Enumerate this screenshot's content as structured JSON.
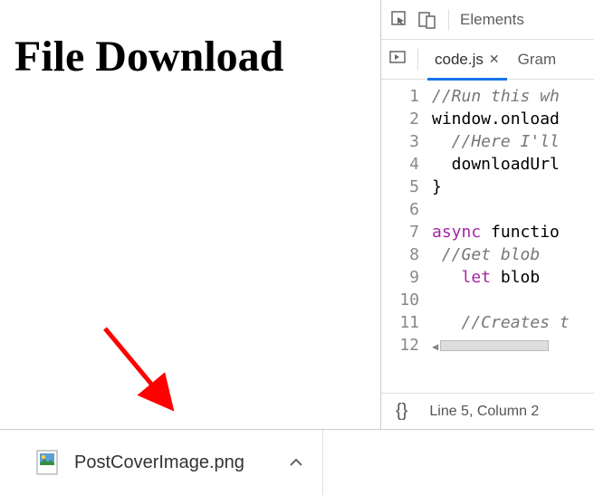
{
  "page": {
    "heading": "File Download"
  },
  "devtools": {
    "top_tabs": {
      "elements": "Elements"
    },
    "file_tabs": {
      "active": "code.js",
      "second": "Gram"
    },
    "code_lines": [
      {
        "n": 1,
        "kind": "comment",
        "text": "//Run this wh"
      },
      {
        "n": 2,
        "kind": "code",
        "text": "window.onload"
      },
      {
        "n": 3,
        "kind": "comment-indent",
        "text": "  //Here I'll"
      },
      {
        "n": 4,
        "kind": "code-indent",
        "text": "  downloadUrl"
      },
      {
        "n": 5,
        "kind": "code",
        "text": "}"
      },
      {
        "n": 6,
        "kind": "blank",
        "text": ""
      },
      {
        "n": 7,
        "kind": "async",
        "pre": "async",
        "post": " functio"
      },
      {
        "n": 8,
        "kind": "comment-indent",
        "text": " //Get blob "
      },
      {
        "n": 9,
        "kind": "let",
        "pre": "   let",
        "post": " blob "
      },
      {
        "n": 10,
        "kind": "blank",
        "text": ""
      },
      {
        "n": 11,
        "kind": "comment-indent",
        "text": "   //Creates t"
      },
      {
        "n": 12,
        "kind": "scrollbar",
        "text": ""
      }
    ],
    "status": {
      "braces": "{}",
      "cursor": "Line 5, Column 2"
    }
  },
  "download": {
    "filename": "PostCoverImage.png"
  }
}
